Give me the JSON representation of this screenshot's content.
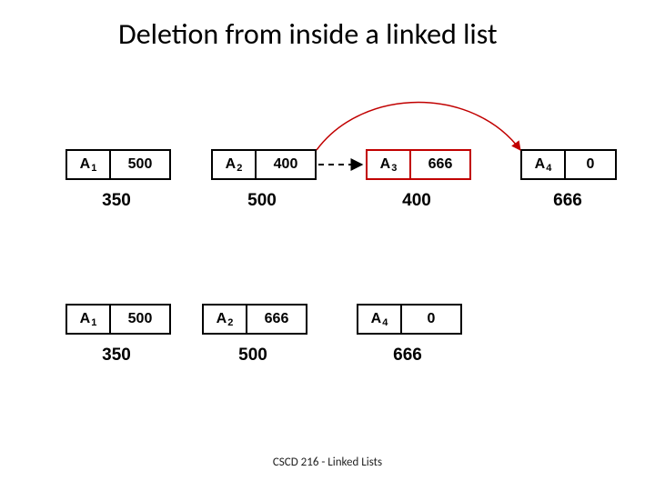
{
  "title": "Deletion from inside a linked list",
  "footer": "CSCD 216 - Linked Lists",
  "nodes": {
    "a": "A",
    "row1": {
      "n1": {
        "sub": "1",
        "ptr": "500",
        "addr": "350"
      },
      "n2": {
        "sub": "2",
        "ptr": "400",
        "addr": "500"
      },
      "n3": {
        "sub": "3",
        "ptr": "666",
        "addr": "400"
      },
      "n4": {
        "sub": "4",
        "ptr": "0",
        "addr": "666"
      }
    },
    "row2": {
      "n1": {
        "sub": "1",
        "ptr": "500",
        "addr": "350"
      },
      "n2": {
        "sub": "2",
        "ptr": "666",
        "addr": "500"
      },
      "n4": {
        "sub": "4",
        "ptr": "0",
        "addr": "666"
      }
    }
  },
  "chart_data": {
    "type": "diagram",
    "description": "Singly linked list node deletion",
    "before": [
      {
        "name": "A1",
        "address": 350,
        "next": 500
      },
      {
        "name": "A2",
        "address": 500,
        "next": 400
      },
      {
        "name": "A3",
        "address": 400,
        "next": 666
      },
      {
        "name": "A4",
        "address": 666,
        "next": 0
      }
    ],
    "after": [
      {
        "name": "A1",
        "address": 350,
        "next": 500
      },
      {
        "name": "A2",
        "address": 500,
        "next": 666
      },
      {
        "name": "A4",
        "address": 666,
        "next": 0
      }
    ],
    "deleted_node": "A3",
    "bypass_pointer": {
      "from_node": "A2",
      "old_next": 400,
      "new_next": 666
    }
  }
}
